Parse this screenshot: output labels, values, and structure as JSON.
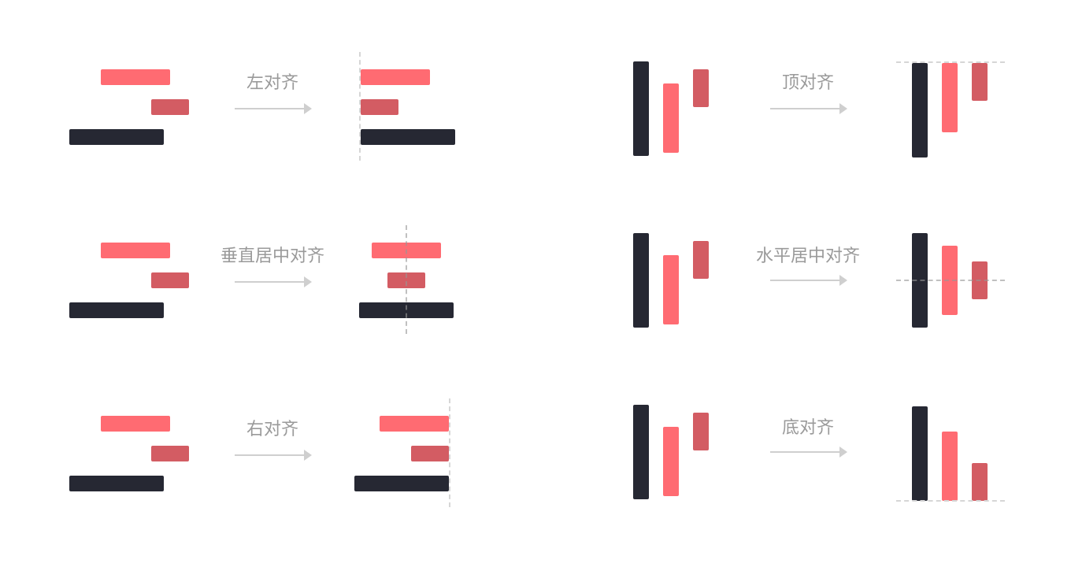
{
  "labels": {
    "left_align": "左对齐",
    "vertical_center_align": "垂直居中对齐",
    "right_align": "右对齐",
    "top_align": "顶对齐",
    "horizontal_center_align": "水平居中对齐",
    "bottom_align": "底对齐"
  },
  "colors": {
    "dark_bar": "#262833",
    "pink_bar": "#ff6b72",
    "rose_bar": "#d35c63",
    "guide_line": "#d6d6d6",
    "label_text": "#9a9a9a",
    "arrow": "#cfcfcf"
  }
}
